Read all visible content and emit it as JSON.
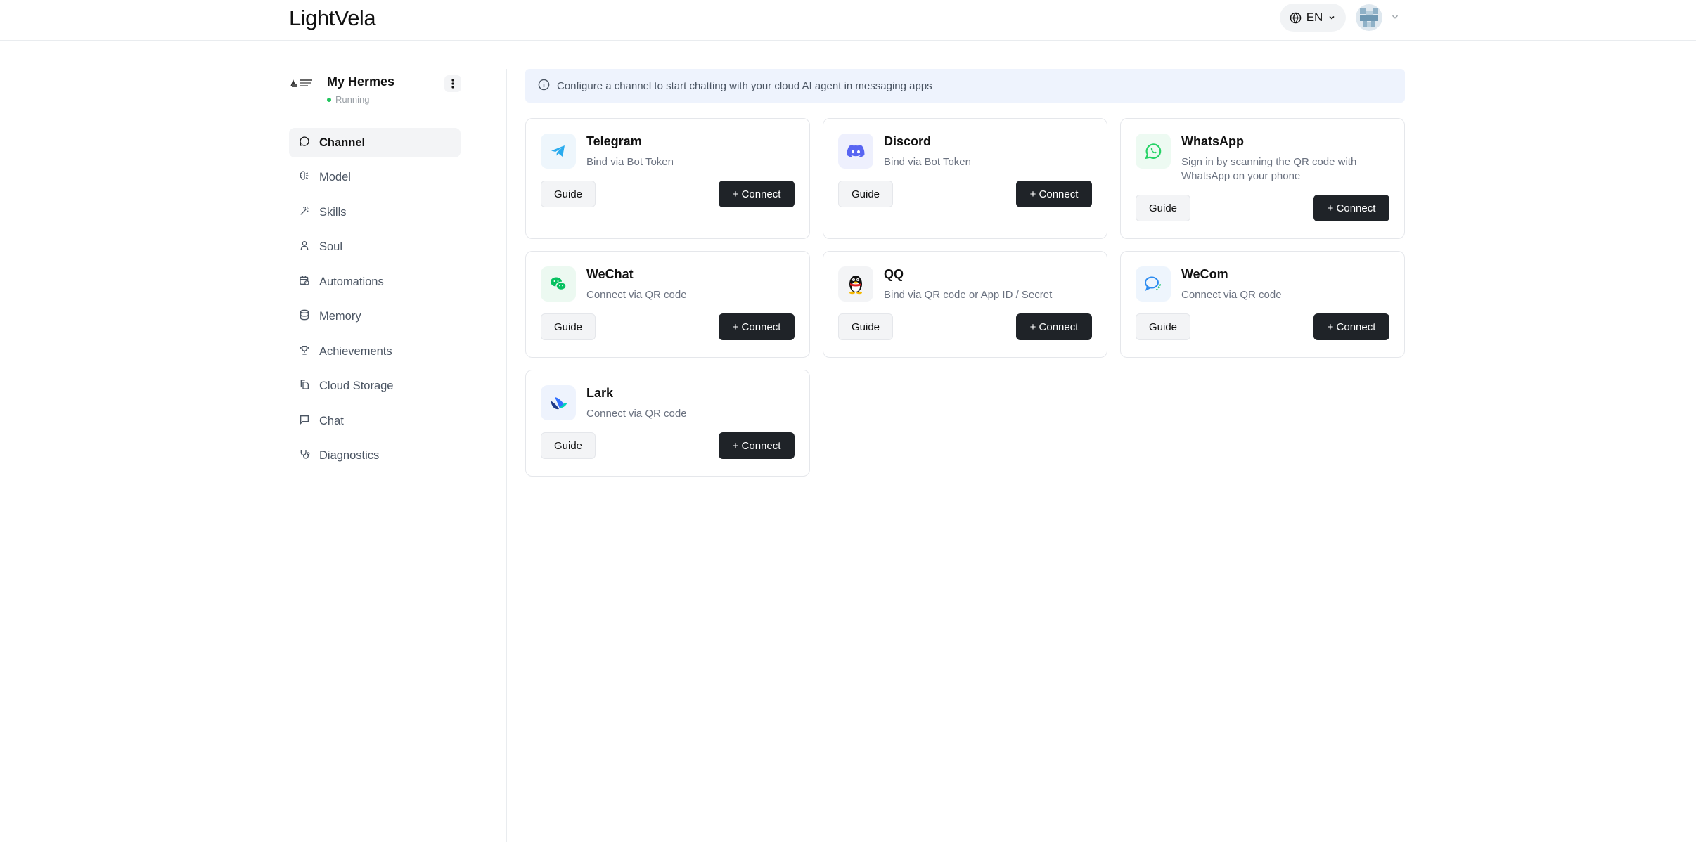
{
  "header": {
    "logo": "LightVela",
    "language": "EN"
  },
  "sidebar": {
    "agent_name": "My Hermes",
    "agent_status": "Running",
    "items": [
      {
        "label": "Channel",
        "icon": "message-circle-icon",
        "active": true
      },
      {
        "label": "Model",
        "icon": "brain-icon",
        "active": false
      },
      {
        "label": "Skills",
        "icon": "wand-icon",
        "active": false
      },
      {
        "label": "Soul",
        "icon": "user-icon",
        "active": false
      },
      {
        "label": "Automations",
        "icon": "calendar-clock-icon",
        "active": false
      },
      {
        "label": "Memory",
        "icon": "database-icon",
        "active": false
      },
      {
        "label": "Achievements",
        "icon": "trophy-icon",
        "active": false
      },
      {
        "label": "Cloud Storage",
        "icon": "files-icon",
        "active": false
      },
      {
        "label": "Chat",
        "icon": "message-square-icon",
        "active": false
      },
      {
        "label": "Diagnostics",
        "icon": "stethoscope-icon",
        "active": false
      }
    ]
  },
  "main": {
    "banner": "Configure a channel to start chatting with your cloud AI agent in messaging apps",
    "guide_label": "Guide",
    "connect_label": "+ Connect",
    "channels": [
      {
        "name": "Telegram",
        "desc": "Bind via Bot Token",
        "icon": "telegram-icon",
        "color": "#2AABEE"
      },
      {
        "name": "Discord",
        "desc": "Bind via Bot Token",
        "icon": "discord-icon",
        "color": "#5865F2"
      },
      {
        "name": "WhatsApp",
        "desc": "Sign in by scanning the QR code with WhatsApp on your phone",
        "icon": "whatsapp-icon",
        "color": "#25D366"
      },
      {
        "name": "WeChat",
        "desc": "Connect via QR code",
        "icon": "wechat-icon",
        "color": "#07C160"
      },
      {
        "name": "QQ",
        "desc": "Bind via QR code or App ID / Secret",
        "icon": "qq-penguin-icon",
        "color": "#111111"
      },
      {
        "name": "WeCom",
        "desc": "Connect via QR code",
        "icon": "wecom-icon",
        "color": "#2D8CF0"
      },
      {
        "name": "Lark",
        "desc": "Connect via QR code",
        "icon": "lark-icon",
        "color": "#3370FF"
      }
    ]
  }
}
